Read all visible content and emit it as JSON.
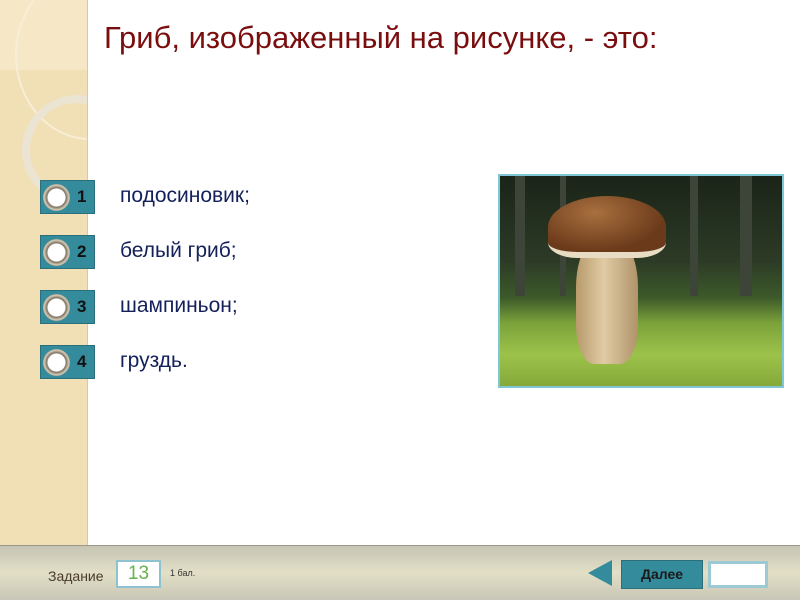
{
  "question": {
    "title": "Гриб, изображенный на рисунке, - это:"
  },
  "options": [
    {
      "number": "1",
      "label": "подосиновик;"
    },
    {
      "number": "2",
      "label": "белый гриб;"
    },
    {
      "number": "3",
      "label": "шампиньон;"
    },
    {
      "number": "4",
      "label": "груздь."
    }
  ],
  "footer": {
    "task_label": "Задание",
    "task_number": "13",
    "score": "1 бал.",
    "next_label": "Далее"
  },
  "colors": {
    "accent": "#338b9b",
    "title": "#7a0e0e",
    "answer_text": "#14205a"
  }
}
